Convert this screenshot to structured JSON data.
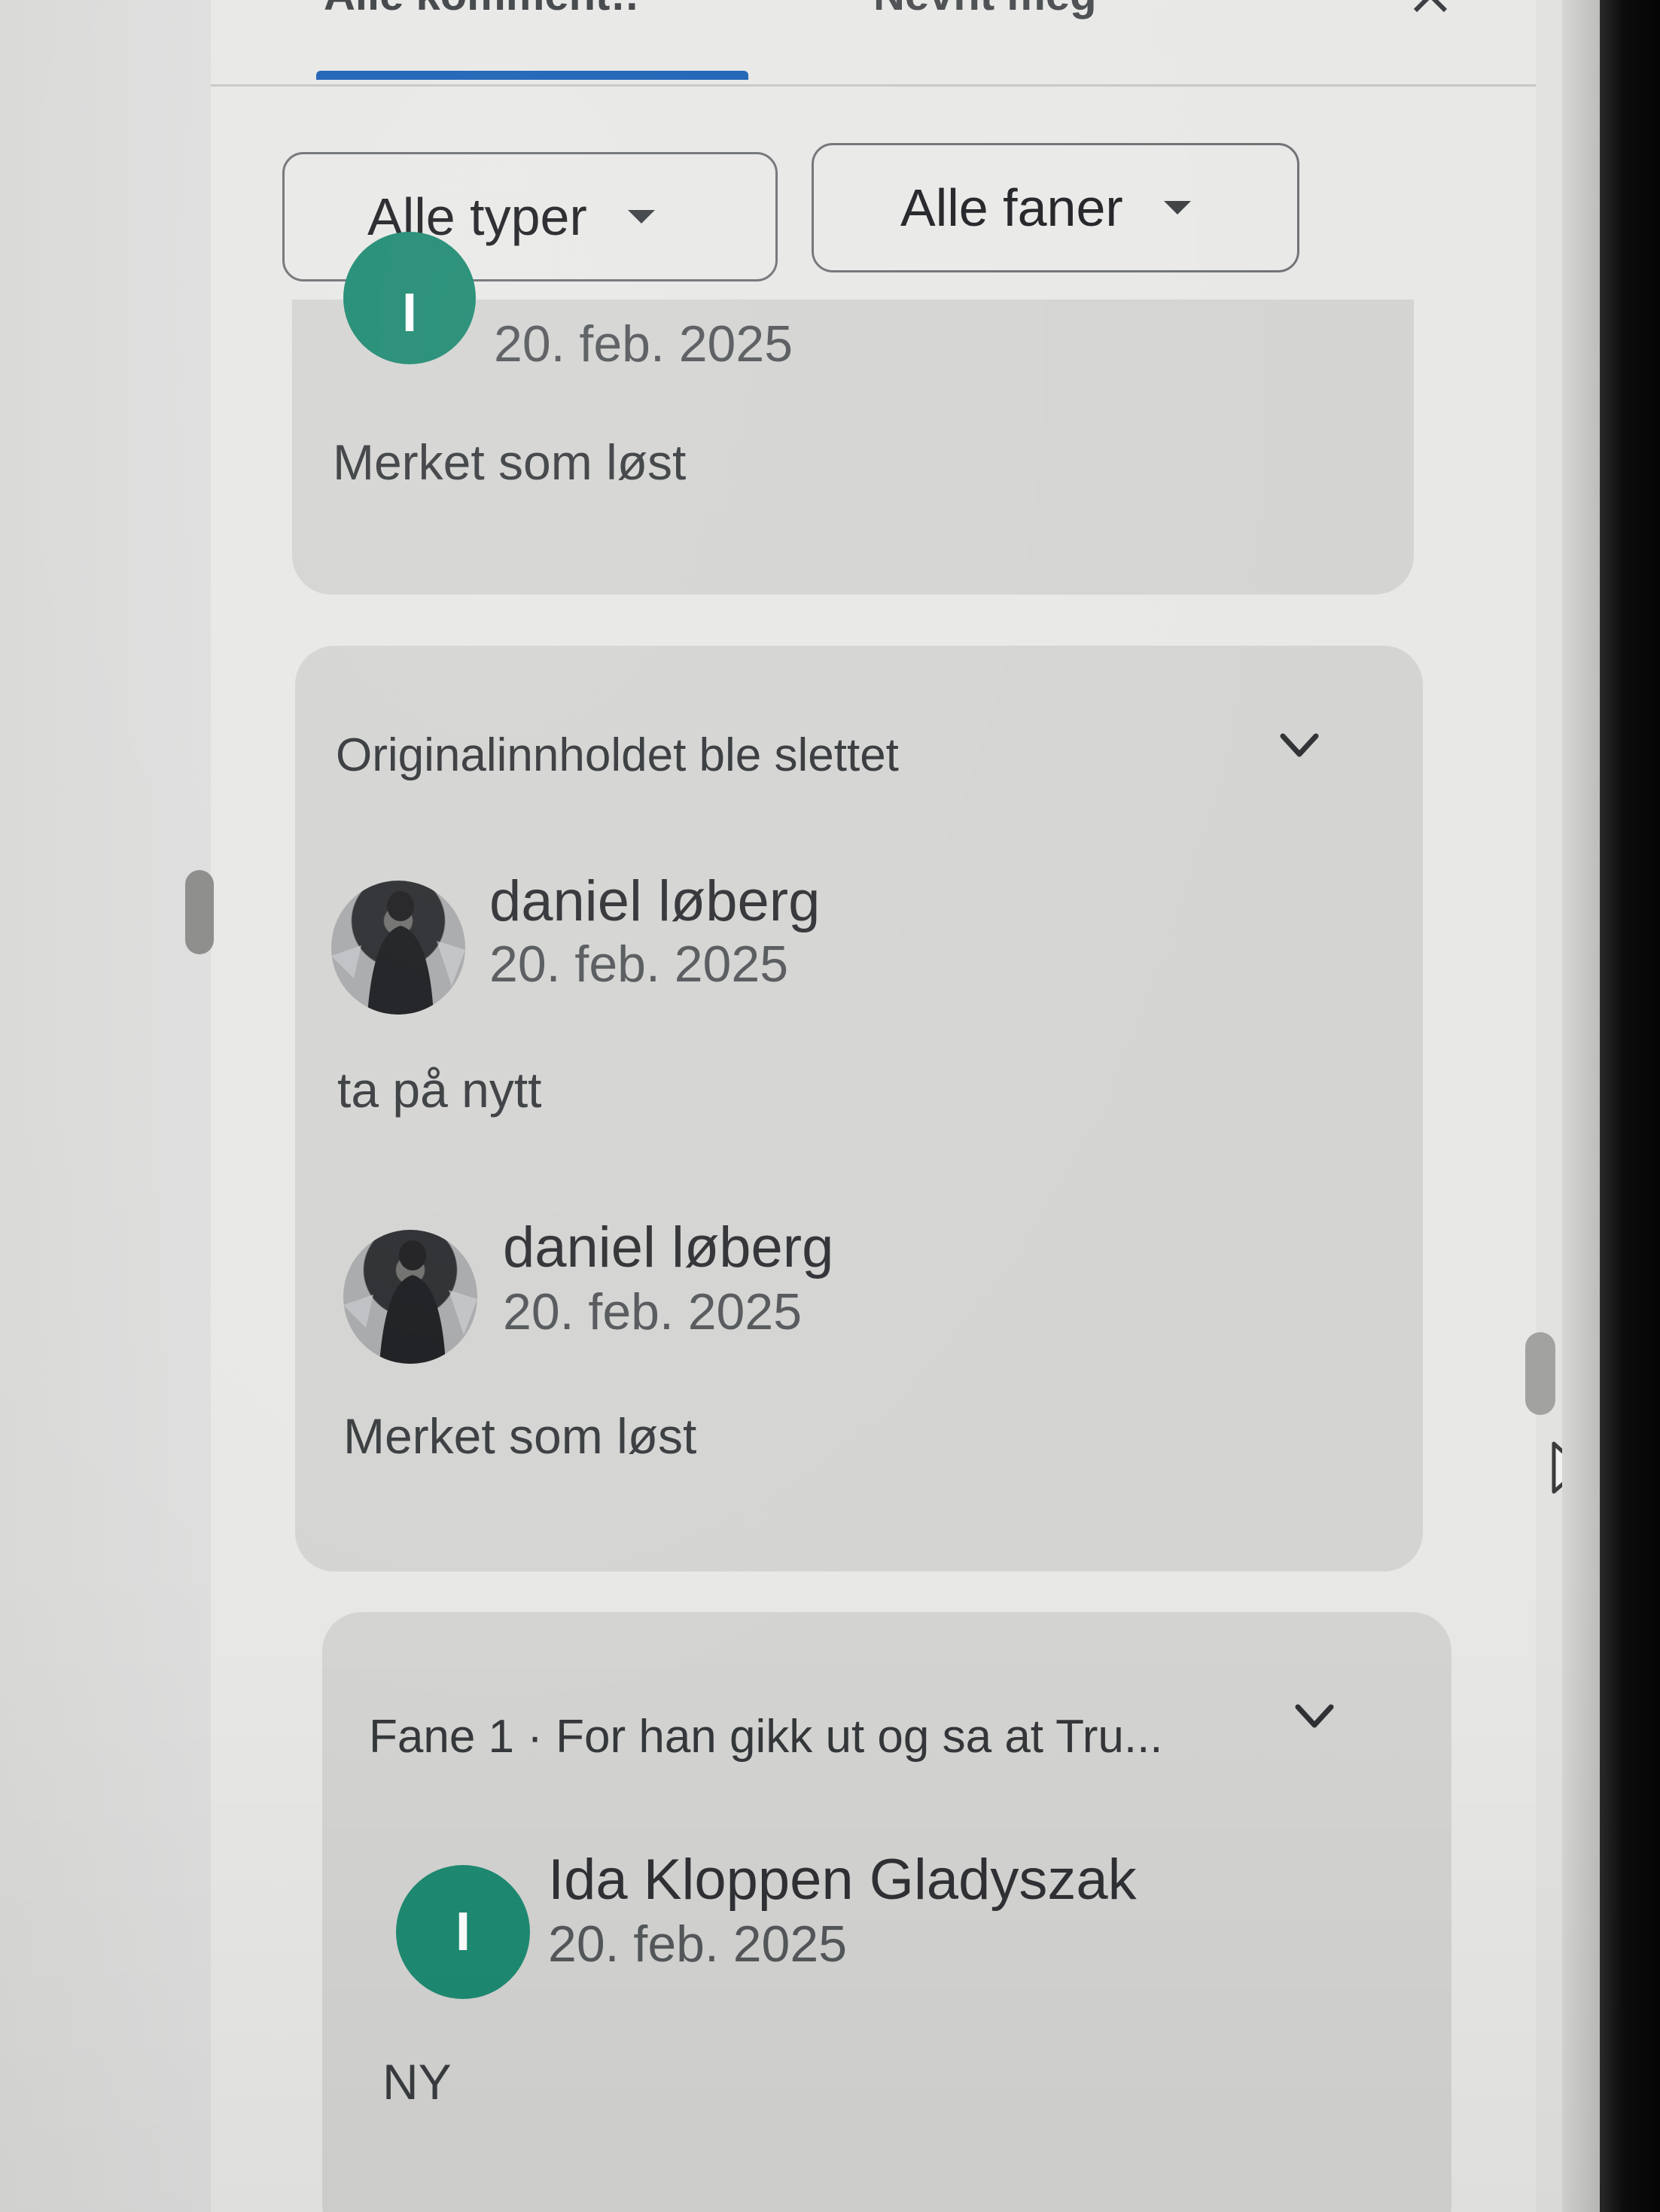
{
  "tabs": {
    "first_label": "Alle komment…",
    "second_label": "Nevnt meg"
  },
  "filters": {
    "types_label": "Alle typer",
    "tabs_label": "Alle faner"
  },
  "cards": [
    {
      "avatar_letter": "I",
      "date": "20. feb. 2025",
      "body": "Merket som løst"
    },
    {
      "heading": "Originalinnholdet ble slettet",
      "comments": [
        {
          "author": "daniel løberg",
          "date": "20. feb. 2025",
          "body": "ta på nytt"
        },
        {
          "author": "daniel løberg",
          "date": "20. feb. 2025",
          "body": "Merket som løst"
        }
      ]
    },
    {
      "heading": "Fane 1 · For han gikk ut og sa at Tru...",
      "comments": [
        {
          "author": "Ida Kloppen Gladyszak",
          "avatar_letter": "I",
          "date": "20. feb. 2025",
          "body": "NY"
        }
      ]
    }
  ],
  "colors": {
    "accent": "#1a5fb4",
    "avatar_green": "#1e8a72",
    "card_bg": "#d4d4d2"
  },
  "icons": {
    "dropdown": "caret-down-icon",
    "expand": "chevron-down-icon",
    "pointer": "mouse-pointer-icon"
  }
}
